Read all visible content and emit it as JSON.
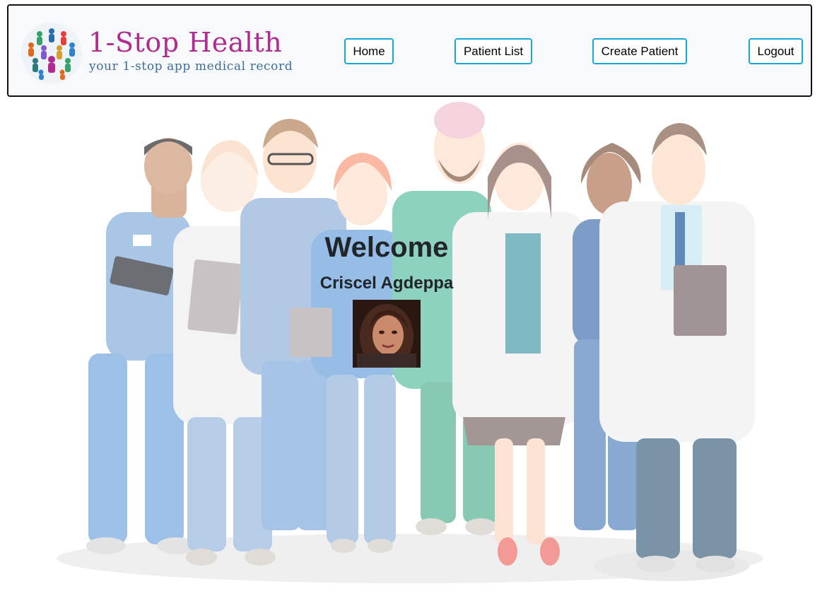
{
  "brand": {
    "title": "1-Stop Health",
    "tagline": "your 1-stop app medical record",
    "logo_icon": "people-globe-icon",
    "title_color": "#b12a8f",
    "tagline_color": "#3a6f9b"
  },
  "nav": {
    "home": "Home",
    "patient_list": "Patient List",
    "create_patient": "Create Patient",
    "logout": "Logout",
    "button_border_color": "#17a7d8"
  },
  "main": {
    "welcome": "Welcome",
    "user_name": "Criscel Agdeppa",
    "background_illustration": "medical-team-illustration",
    "avatar_icon": "user-avatar"
  }
}
